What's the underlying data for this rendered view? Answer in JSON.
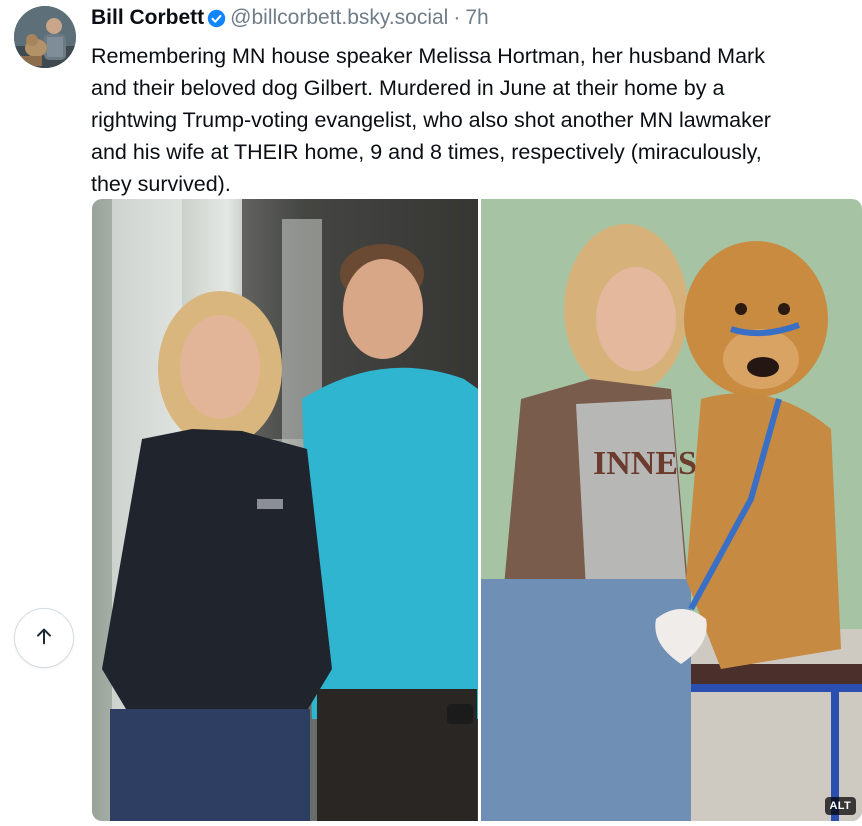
{
  "post": {
    "author_name": "Bill Corbett",
    "handle": "@billcorbett.bsky.social",
    "separator": "·",
    "time": "7h",
    "text": "Remembering MN house speaker Melissa Hortman, her husband Mark\nand their beloved dog Gilbert. Murdered in June at their home by a\nrightwing Trump-voting evangelist, who also shot another MN lawmaker\nand his wife at THEIR home, 9 and 8 times, respectively (miraculously,\nthey survived).",
    "images": [
      {
        "name": "photo-couple-waterfall"
      },
      {
        "name": "photo-woman-with-golden-retriever",
        "shirt_text": "INNES"
      }
    ],
    "alt_label": "ALT"
  },
  "icons": {
    "verified": "verified-badge-icon",
    "scroll_top": "arrow-up-icon"
  },
  "colors": {
    "text": "#0b0f14",
    "muted": "#6f7d89",
    "verified_blue": "#1185fe",
    "border": "#d4dbe2"
  }
}
